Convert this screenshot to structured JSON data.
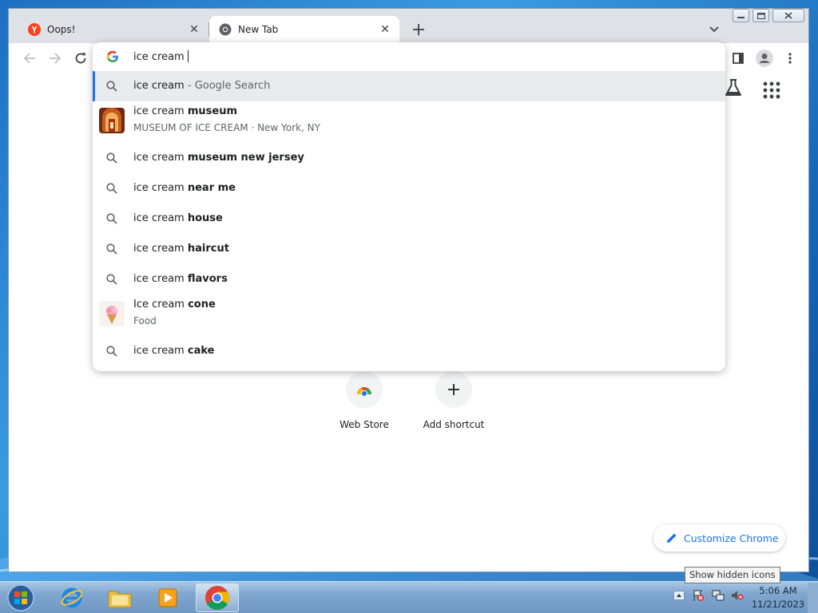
{
  "browser": {
    "tabs": [
      {
        "title": "Oops!",
        "favicon": "yandex-icon",
        "active": false
      },
      {
        "title": "New Tab",
        "favicon": "chrome-icon",
        "active": true
      }
    ]
  },
  "omnibox": {
    "typed_text": "ice cream",
    "suggestions": [
      {
        "prefix": "ice cream",
        "bold": "",
        "suffix": " - Google Search",
        "icon": "search-icon",
        "selected": true
      },
      {
        "prefix": "ice cream ",
        "bold": "museum",
        "subtitle": "MUSEUM OF ICE CREAM · New York, NY",
        "icon": "museum-thumbnail"
      },
      {
        "prefix": "ice cream ",
        "bold": "museum new jersey",
        "icon": "search-icon"
      },
      {
        "prefix": "ice cream ",
        "bold": "near me",
        "icon": "search-icon"
      },
      {
        "prefix": "ice cream ",
        "bold": "house",
        "icon": "search-icon"
      },
      {
        "prefix": "ice cream ",
        "bold": "haircut",
        "icon": "search-icon"
      },
      {
        "prefix": "ice cream ",
        "bold": "flavors",
        "icon": "search-icon"
      },
      {
        "prefix": "Ice cream ",
        "bold": "cone",
        "subtitle": "Food",
        "icon": "ice-cream-thumbnail"
      },
      {
        "prefix": "ice cream ",
        "bold": "cake",
        "icon": "search-icon"
      }
    ]
  },
  "ntp": {
    "shortcuts": [
      {
        "label": "Web Store",
        "icon": "webstore-icon"
      },
      {
        "label": "Add shortcut",
        "icon": "plus-icon"
      }
    ],
    "customize_label": "Customize Chrome"
  },
  "taskbar": {
    "tooltip": "Show hidden icons",
    "time": "5:06 AM",
    "date": "11/21/2023"
  },
  "colors": {
    "accent": "#1a73e8",
    "taskbar": "#7ea6cf"
  }
}
